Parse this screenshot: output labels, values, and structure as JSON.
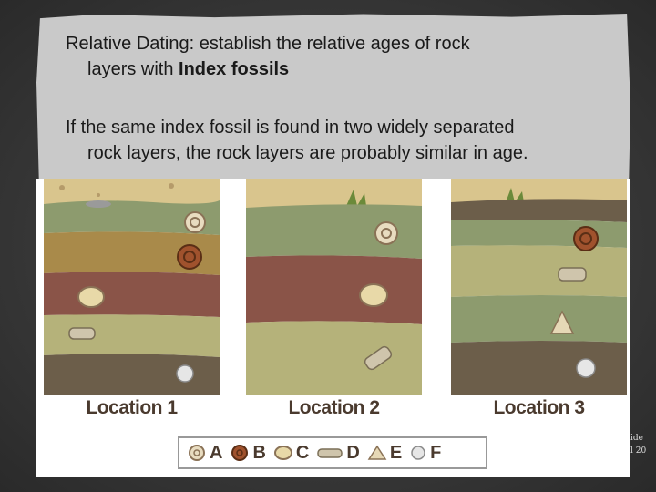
{
  "slide": {
    "paragraph1": {
      "term": "Relative Dating",
      "text": ": establish the relative ages of rock",
      "line2_text": "layers with ",
      "line2_bold": "Index fossils"
    },
    "paragraph2": {
      "line1": "If the same index fossil is found in two widely separated",
      "line2": "rock layers, the rock layers are probably similar in age."
    },
    "corner_note": {
      "line1": "ide",
      "line2": "l 20"
    }
  },
  "figure": {
    "locations": [
      {
        "label": "Location 1",
        "fossils_top_to_bottom": [
          "A",
          "B",
          "C",
          "D",
          "F"
        ]
      },
      {
        "label": "Location 2",
        "fossils_top_to_bottom": [
          "A",
          "C",
          "D"
        ]
      },
      {
        "label": "Location 3",
        "fossils_top_to_bottom": [
          "B",
          "D",
          "E",
          "F"
        ]
      }
    ],
    "legend": [
      {
        "letter": "A",
        "icon": "coiled-shell-icon"
      },
      {
        "letter": "B",
        "icon": "ammonite-icon"
      },
      {
        "letter": "C",
        "icon": "clam-shell-icon"
      },
      {
        "letter": "D",
        "icon": "trilobite-icon"
      },
      {
        "letter": "E",
        "icon": "scallop-icon"
      },
      {
        "letter": "F",
        "icon": "coral-icon"
      }
    ]
  },
  "colors": {
    "soil": "#d8c38a",
    "layer_green": "#8a9a6c",
    "layer_brown": "#8a5448",
    "layer_olive": "#b5b27a",
    "layer_dark": "#6c5e4a"
  }
}
